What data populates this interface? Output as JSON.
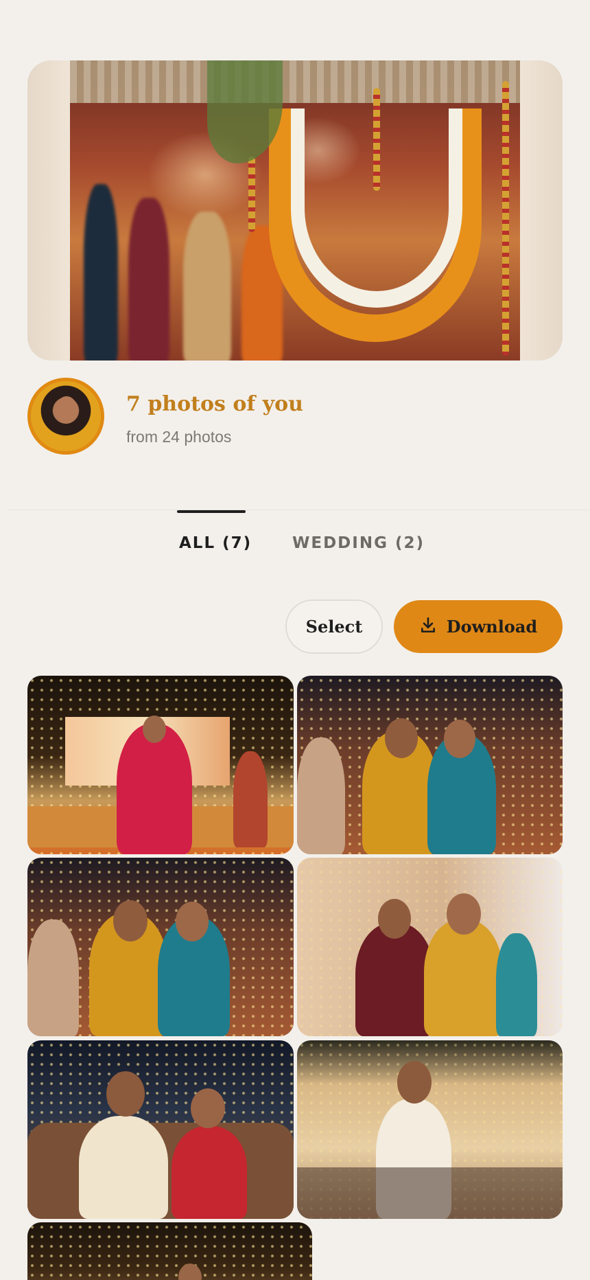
{
  "profile": {
    "title": "7 photos of you",
    "subtitle": "from 24 photos"
  },
  "tabs": [
    {
      "label": "ALL (7)",
      "active": true
    },
    {
      "label": "WEDDING (2)",
      "active": false
    }
  ],
  "actions": {
    "select_label": "Select",
    "download_label": "Download"
  },
  "icons": {
    "download": "download-icon"
  },
  "colors": {
    "accent": "#df8816",
    "title": "#c17f1d",
    "background": "#f3f0ec"
  },
  "photos": [
    {
      "name": "photo-dancing-bride"
    },
    {
      "name": "photo-selfie-friends"
    },
    {
      "name": "photo-selfie-friends-2"
    },
    {
      "name": "photo-mother-daughter"
    },
    {
      "name": "photo-seated-couple"
    },
    {
      "name": "photo-speech-microphone"
    },
    {
      "name": "photo-seventh"
    }
  ]
}
